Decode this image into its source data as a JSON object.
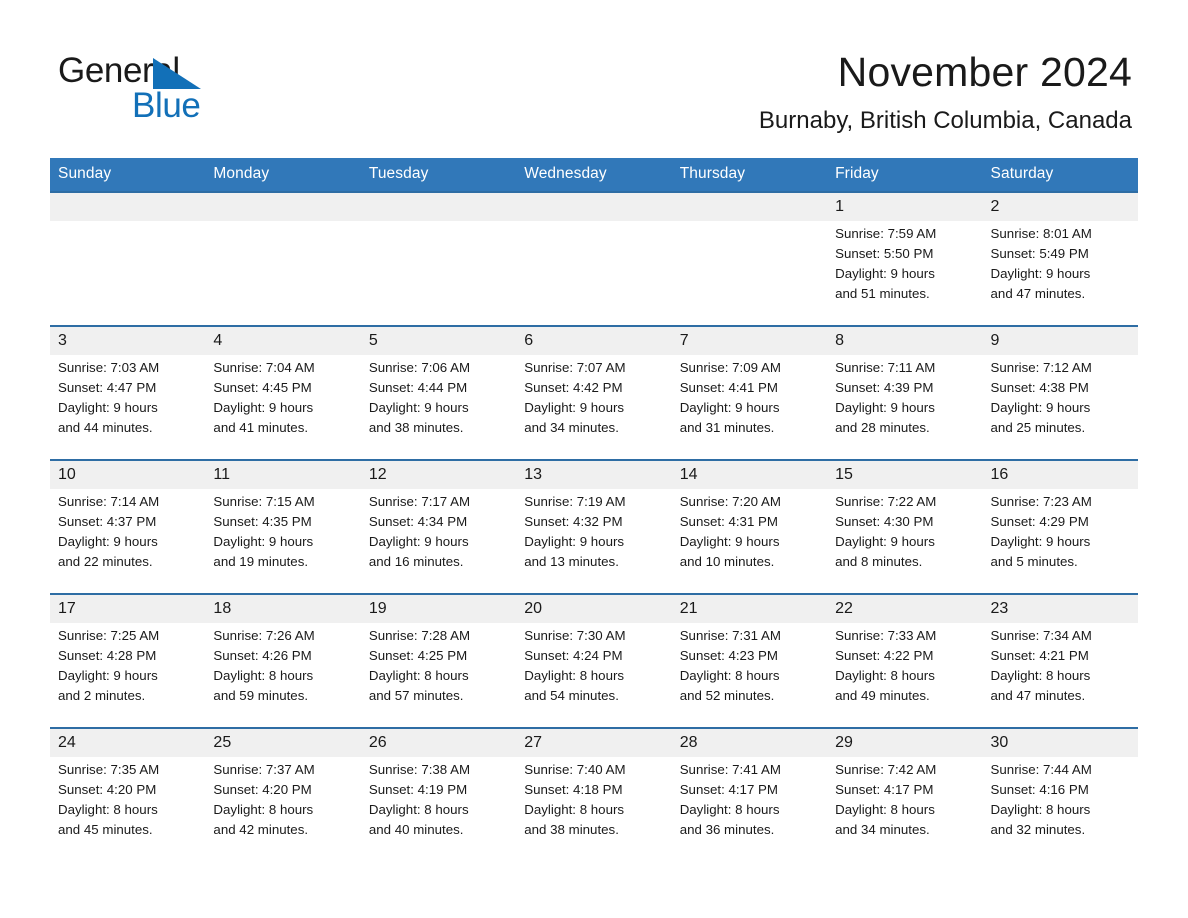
{
  "brand": {
    "name_part1": "General",
    "name_part2": "Blue",
    "logo_icon": "triangle-icon",
    "accent_color": "#1270b8"
  },
  "header": {
    "title": "November 2024",
    "location": "Burnaby, British Columbia, Canada"
  },
  "colors": {
    "header_blue": "#3178b9",
    "week_separator_blue": "#2e6da4",
    "daynum_band": "#f0f0f0",
    "text": "#1a1a1a"
  },
  "weekday_headers": [
    "Sunday",
    "Monday",
    "Tuesday",
    "Wednesday",
    "Thursday",
    "Friday",
    "Saturday"
  ],
  "weeks": [
    {
      "days": [
        {
          "num": "",
          "l1": "",
          "l2": "",
          "l3": "",
          "l4": ""
        },
        {
          "num": "",
          "l1": "",
          "l2": "",
          "l3": "",
          "l4": ""
        },
        {
          "num": "",
          "l1": "",
          "l2": "",
          "l3": "",
          "l4": ""
        },
        {
          "num": "",
          "l1": "",
          "l2": "",
          "l3": "",
          "l4": ""
        },
        {
          "num": "",
          "l1": "",
          "l2": "",
          "l3": "",
          "l4": ""
        },
        {
          "num": "1",
          "l1": "Sunrise: 7:59 AM",
          "l2": "Sunset: 5:50 PM",
          "l3": "Daylight: 9 hours",
          "l4": "and 51 minutes."
        },
        {
          "num": "2",
          "l1": "Sunrise: 8:01 AM",
          "l2": "Sunset: 5:49 PM",
          "l3": "Daylight: 9 hours",
          "l4": "and 47 minutes."
        }
      ]
    },
    {
      "days": [
        {
          "num": "3",
          "l1": "Sunrise: 7:03 AM",
          "l2": "Sunset: 4:47 PM",
          "l3": "Daylight: 9 hours",
          "l4": "and 44 minutes."
        },
        {
          "num": "4",
          "l1": "Sunrise: 7:04 AM",
          "l2": "Sunset: 4:45 PM",
          "l3": "Daylight: 9 hours",
          "l4": "and 41 minutes."
        },
        {
          "num": "5",
          "l1": "Sunrise: 7:06 AM",
          "l2": "Sunset: 4:44 PM",
          "l3": "Daylight: 9 hours",
          "l4": "and 38 minutes."
        },
        {
          "num": "6",
          "l1": "Sunrise: 7:07 AM",
          "l2": "Sunset: 4:42 PM",
          "l3": "Daylight: 9 hours",
          "l4": "and 34 minutes."
        },
        {
          "num": "7",
          "l1": "Sunrise: 7:09 AM",
          "l2": "Sunset: 4:41 PM",
          "l3": "Daylight: 9 hours",
          "l4": "and 31 minutes."
        },
        {
          "num": "8",
          "l1": "Sunrise: 7:11 AM",
          "l2": "Sunset: 4:39 PM",
          "l3": "Daylight: 9 hours",
          "l4": "and 28 minutes."
        },
        {
          "num": "9",
          "l1": "Sunrise: 7:12 AM",
          "l2": "Sunset: 4:38 PM",
          "l3": "Daylight: 9 hours",
          "l4": "and 25 minutes."
        }
      ]
    },
    {
      "days": [
        {
          "num": "10",
          "l1": "Sunrise: 7:14 AM",
          "l2": "Sunset: 4:37 PM",
          "l3": "Daylight: 9 hours",
          "l4": "and 22 minutes."
        },
        {
          "num": "11",
          "l1": "Sunrise: 7:15 AM",
          "l2": "Sunset: 4:35 PM",
          "l3": "Daylight: 9 hours",
          "l4": "and 19 minutes."
        },
        {
          "num": "12",
          "l1": "Sunrise: 7:17 AM",
          "l2": "Sunset: 4:34 PM",
          "l3": "Daylight: 9 hours",
          "l4": "and 16 minutes."
        },
        {
          "num": "13",
          "l1": "Sunrise: 7:19 AM",
          "l2": "Sunset: 4:32 PM",
          "l3": "Daylight: 9 hours",
          "l4": "and 13 minutes."
        },
        {
          "num": "14",
          "l1": "Sunrise: 7:20 AM",
          "l2": "Sunset: 4:31 PM",
          "l3": "Daylight: 9 hours",
          "l4": "and 10 minutes."
        },
        {
          "num": "15",
          "l1": "Sunrise: 7:22 AM",
          "l2": "Sunset: 4:30 PM",
          "l3": "Daylight: 9 hours",
          "l4": "and 8 minutes."
        },
        {
          "num": "16",
          "l1": "Sunrise: 7:23 AM",
          "l2": "Sunset: 4:29 PM",
          "l3": "Daylight: 9 hours",
          "l4": "and 5 minutes."
        }
      ]
    },
    {
      "days": [
        {
          "num": "17",
          "l1": "Sunrise: 7:25 AM",
          "l2": "Sunset: 4:28 PM",
          "l3": "Daylight: 9 hours",
          "l4": "and 2 minutes."
        },
        {
          "num": "18",
          "l1": "Sunrise: 7:26 AM",
          "l2": "Sunset: 4:26 PM",
          "l3": "Daylight: 8 hours",
          "l4": "and 59 minutes."
        },
        {
          "num": "19",
          "l1": "Sunrise: 7:28 AM",
          "l2": "Sunset: 4:25 PM",
          "l3": "Daylight: 8 hours",
          "l4": "and 57 minutes."
        },
        {
          "num": "20",
          "l1": "Sunrise: 7:30 AM",
          "l2": "Sunset: 4:24 PM",
          "l3": "Daylight: 8 hours",
          "l4": "and 54 minutes."
        },
        {
          "num": "21",
          "l1": "Sunrise: 7:31 AM",
          "l2": "Sunset: 4:23 PM",
          "l3": "Daylight: 8 hours",
          "l4": "and 52 minutes."
        },
        {
          "num": "22",
          "l1": "Sunrise: 7:33 AM",
          "l2": "Sunset: 4:22 PM",
          "l3": "Daylight: 8 hours",
          "l4": "and 49 minutes."
        },
        {
          "num": "23",
          "l1": "Sunrise: 7:34 AM",
          "l2": "Sunset: 4:21 PM",
          "l3": "Daylight: 8 hours",
          "l4": "and 47 minutes."
        }
      ]
    },
    {
      "days": [
        {
          "num": "24",
          "l1": "Sunrise: 7:35 AM",
          "l2": "Sunset: 4:20 PM",
          "l3": "Daylight: 8 hours",
          "l4": "and 45 minutes."
        },
        {
          "num": "25",
          "l1": "Sunrise: 7:37 AM",
          "l2": "Sunset: 4:20 PM",
          "l3": "Daylight: 8 hours",
          "l4": "and 42 minutes."
        },
        {
          "num": "26",
          "l1": "Sunrise: 7:38 AM",
          "l2": "Sunset: 4:19 PM",
          "l3": "Daylight: 8 hours",
          "l4": "and 40 minutes."
        },
        {
          "num": "27",
          "l1": "Sunrise: 7:40 AM",
          "l2": "Sunset: 4:18 PM",
          "l3": "Daylight: 8 hours",
          "l4": "and 38 minutes."
        },
        {
          "num": "28",
          "l1": "Sunrise: 7:41 AM",
          "l2": "Sunset: 4:17 PM",
          "l3": "Daylight: 8 hours",
          "l4": "and 36 minutes."
        },
        {
          "num": "29",
          "l1": "Sunrise: 7:42 AM",
          "l2": "Sunset: 4:17 PM",
          "l3": "Daylight: 8 hours",
          "l4": "and 34 minutes."
        },
        {
          "num": "30",
          "l1": "Sunrise: 7:44 AM",
          "l2": "Sunset: 4:16 PM",
          "l3": "Daylight: 8 hours",
          "l4": "and 32 minutes."
        }
      ]
    }
  ]
}
